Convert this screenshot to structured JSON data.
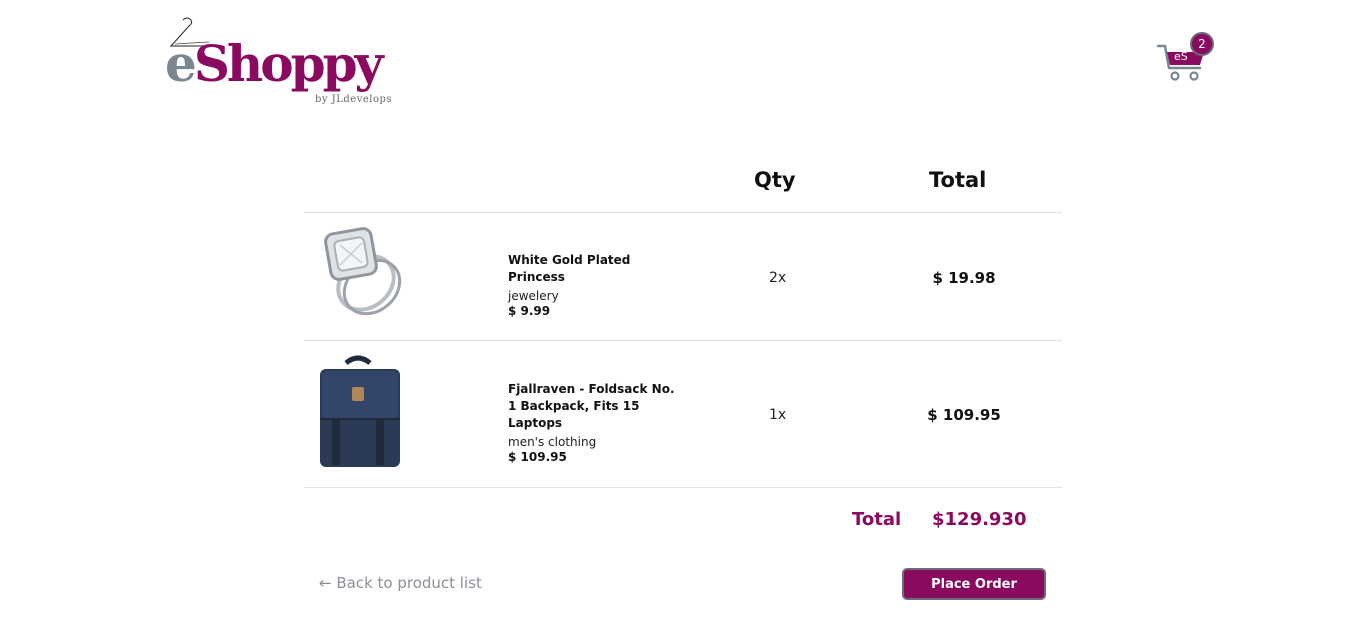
{
  "header": {
    "logo": {
      "prefix": "e",
      "name": "Shoppy",
      "byline": "by JLdevelops"
    },
    "cart": {
      "initials": "eS",
      "count": "2",
      "icon": "shopping-cart-icon"
    }
  },
  "table": {
    "headers": {
      "qty": "Qty",
      "total": "Total"
    },
    "items": [
      {
        "name": "White Gold Plated Princess",
        "category": "jewelery",
        "price": "$ 9.99",
        "qty": "2x",
        "total": "$ 19.98",
        "image": "ring-image"
      },
      {
        "name": "Fjallraven - Foldsack No. 1 Backpack, Fits 15 Laptops",
        "category": "men's clothing",
        "price": "$ 109.95",
        "qty": "1x",
        "total": "$ 109.95",
        "image": "backpack-image"
      }
    ]
  },
  "summary": {
    "label": "Total",
    "value": "$129.930"
  },
  "actions": {
    "back_link": "← Back to product list",
    "place_order": "Place Order"
  },
  "colors": {
    "brand": "#8a0a5f",
    "logo_e": "#7a8790",
    "muted": "#8a8f98"
  }
}
